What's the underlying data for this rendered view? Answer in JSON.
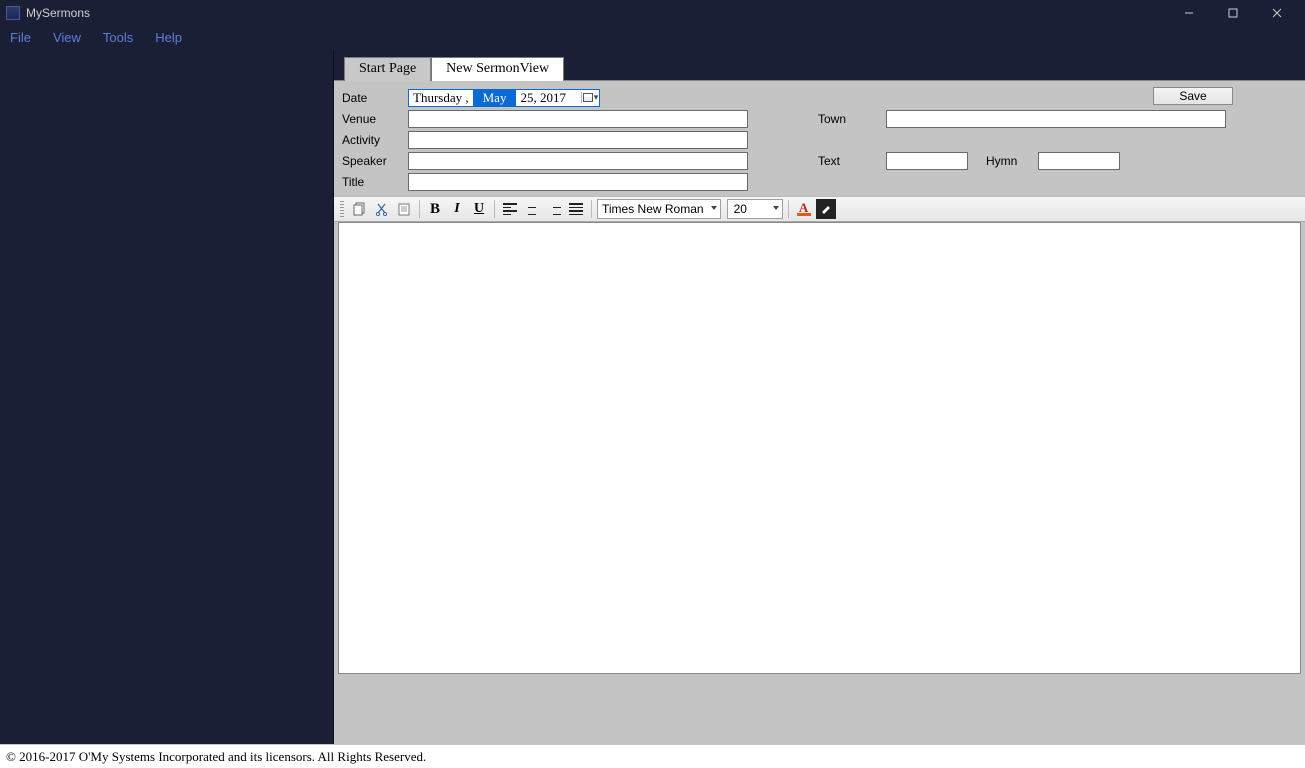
{
  "window": {
    "title": "MySermons"
  },
  "menu": {
    "file": "File",
    "view": "View",
    "tools": "Tools",
    "help": "Help"
  },
  "tabs": {
    "start": "Start Page",
    "new": "New SermonView"
  },
  "form": {
    "labels": {
      "date": "Date",
      "venue": "Venue",
      "activity": "Activity",
      "speaker": "Speaker",
      "title": "Title",
      "town": "Town",
      "text": "Text",
      "hymn": "Hymn"
    },
    "date": {
      "weekday": "Thursday ,",
      "month": "May",
      "rest": "25, 2017"
    },
    "values": {
      "venue": "",
      "activity": "",
      "speaker": "",
      "title": "",
      "town": "",
      "text": "",
      "hymn": ""
    },
    "save": "Save"
  },
  "toolbar": {
    "font": "Times New Roman",
    "size": "20"
  },
  "status": {
    "copyright": "© 2016-2017 O'My Systems Incorporated and its licensors. All Rights Reserved."
  },
  "colors": {
    "accent": "#0a6ad6",
    "chrome": "#1b1f36"
  }
}
